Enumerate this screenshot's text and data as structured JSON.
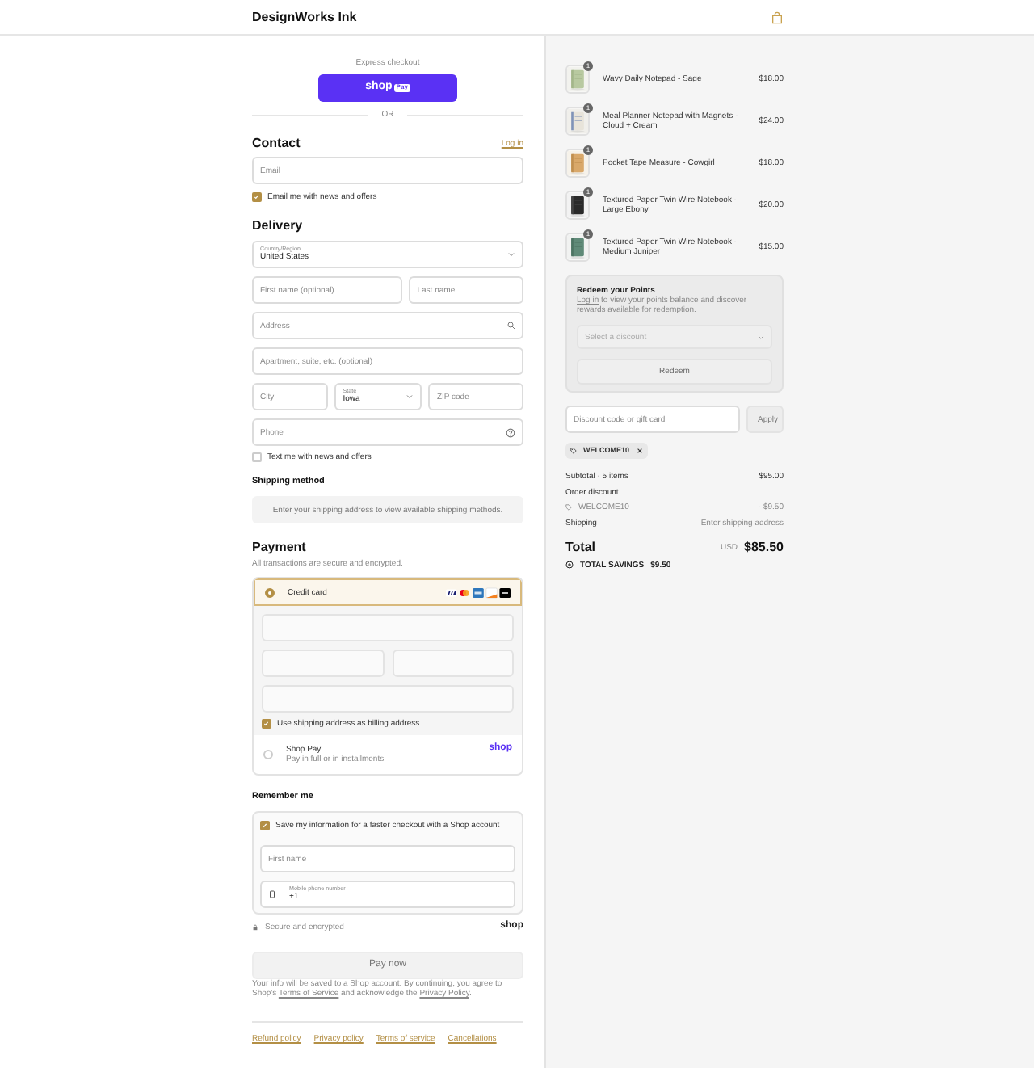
{
  "header": {
    "brand": "DesignWorks Ink"
  },
  "express": {
    "label": "Express checkout",
    "shop_word": "shop",
    "shop_badge": "Pay",
    "divider": "OR"
  },
  "contact": {
    "title": "Contact",
    "login": "Log in",
    "email": {
      "placeholder": "Email"
    },
    "news": {
      "label": "Email me with news and offers",
      "checked": true
    }
  },
  "delivery": {
    "title": "Delivery",
    "rows": [
      [
        {
          "kind": "select",
          "label": "Country/Region",
          "value": "United States"
        }
      ],
      [
        {
          "kind": "input",
          "placeholder": "First name (optional)"
        },
        {
          "kind": "input",
          "placeholder": "Last name"
        }
      ],
      [
        {
          "kind": "search",
          "placeholder": "Address"
        }
      ],
      [
        {
          "kind": "input",
          "placeholder": "Apartment, suite, etc. (optional)"
        }
      ],
      [
        {
          "kind": "input",
          "placeholder": "City"
        },
        {
          "kind": "select",
          "label": "State",
          "value": "Iowa"
        },
        {
          "kind": "input",
          "placeholder": "ZIP code"
        }
      ],
      [
        {
          "kind": "help",
          "placeholder": "Phone"
        }
      ]
    ],
    "sms": {
      "label": "Text me with news and offers",
      "checked": false
    }
  },
  "shipping": {
    "title": "Shipping method",
    "note": "Enter your shipping address to view available shipping methods."
  },
  "payment": {
    "title": "Payment",
    "subtitle": "All transactions are secure and encrypted.",
    "methods": [
      {
        "kind": "card",
        "label": "Credit card",
        "selected": true
      },
      {
        "kind": "shop",
        "label": "Shop Pay",
        "sub": "Pay in full or in installments",
        "logo": "shop",
        "selected": false
      }
    ],
    "billing": {
      "label": "Use shipping address as billing address",
      "checked": true
    }
  },
  "remember": {
    "title": "Remember me",
    "save": {
      "label": "Save my information for a faster checkout with a Shop account",
      "checked": true
    },
    "first_name": {
      "placeholder": "First name"
    },
    "phone": {
      "label": "Mobile phone number",
      "value": "+1"
    }
  },
  "secure": {
    "label": "Secure and encrypted",
    "logo": "shop"
  },
  "pay_button": "Pay now",
  "legal": [
    {
      "text": "Your info will be saved to a Shop account. By continuing, you agree to Shop's "
    },
    {
      "link": "Terms of Service"
    },
    {
      "text": " and acknowledge the "
    },
    {
      "link": "Privacy Policy"
    },
    {
      "text": "."
    }
  ],
  "footer_links": [
    "Refund policy",
    "Privacy policy",
    "Terms of service",
    "Cancellations"
  ],
  "items": [
    {
      "name": "Wavy Daily Notepad - Sage",
      "price": "$18.00",
      "qty": "1"
    },
    {
      "name": "Meal Planner Notepad with Magnets - Cloud + Cream",
      "price": "$24.00",
      "qty": "1"
    },
    {
      "name": "Pocket Tape Measure - Cowgirl",
      "price": "$18.00",
      "qty": "1"
    },
    {
      "name": "Textured Paper Twin Wire Notebook - Large Ebony",
      "price": "$20.00",
      "qty": "1"
    },
    {
      "name": "Textured Paper Twin Wire Notebook - Medium Juniper",
      "price": "$15.00",
      "qty": "1"
    }
  ],
  "redeem": {
    "title": "Redeem your Points",
    "login": "Log in",
    "text": " to view your points balance and discover rewards available for redemption.",
    "select": {
      "placeholder": "Select a discount"
    },
    "button": "Redeem"
  },
  "discount": {
    "placeholder": "Discount code or gift card",
    "button": "Apply",
    "tag": "WELCOME10"
  },
  "summary": [
    {
      "kind": "line",
      "label": "Subtotal · 5 items",
      "value": "$95.00"
    },
    {
      "kind": "heading",
      "label": "Order discount"
    },
    {
      "kind": "code",
      "label": "WELCOME10",
      "value": "- $9.50"
    },
    {
      "kind": "line",
      "label": "Shipping",
      "value": "Enter shipping address"
    }
  ],
  "total": {
    "label": "Total",
    "currency": "USD",
    "value": "$85.50"
  },
  "savings": {
    "label": "TOTAL SAVINGS",
    "value": "$9.50"
  }
}
